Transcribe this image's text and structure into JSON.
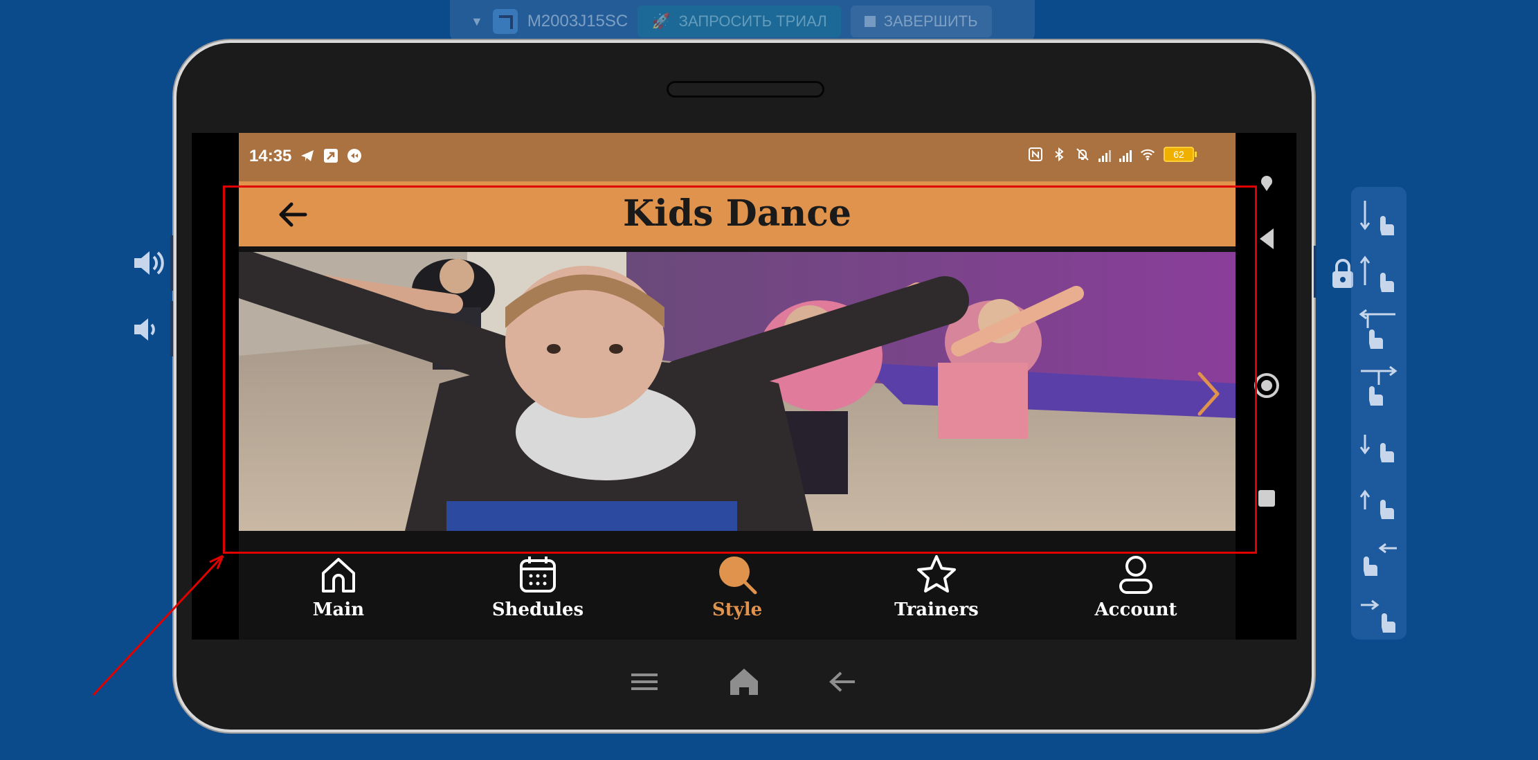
{
  "toolbar": {
    "device_name": "M2003J15SC",
    "trial_label": "ЗАПРОСИТЬ ТРИАЛ",
    "finish_label": "ЗАВЕРШИТЬ"
  },
  "status_bar": {
    "time": "14:35",
    "battery": "62"
  },
  "app_bar": {
    "title": "Kids Dance"
  },
  "bottom_nav": {
    "items": [
      {
        "label": "Main",
        "icon": "home-icon",
        "active": false
      },
      {
        "label": "Shedules",
        "icon": "calendar-icon",
        "active": false
      },
      {
        "label": "Style",
        "icon": "search-icon",
        "active": true
      },
      {
        "label": "Trainers",
        "icon": "star-icon",
        "active": false
      },
      {
        "label": "Account",
        "icon": "person-icon",
        "active": false
      }
    ]
  },
  "colors": {
    "accent": "#e0934d",
    "status_bar": "#aa7240",
    "background": "#0b4a8b",
    "highlight": "#e00000"
  }
}
